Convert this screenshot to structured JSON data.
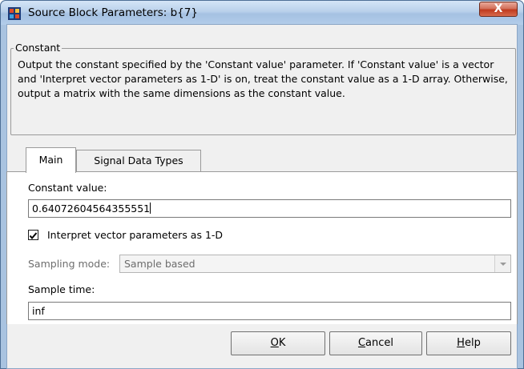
{
  "window": {
    "title": "Source Block Parameters: b{7}",
    "close_label": "X"
  },
  "block": {
    "group_label": "Constant",
    "description": "Output the constant specified by the 'Constant value' parameter. If 'Constant value' is a vector and 'Interpret vector parameters as 1-D' is on, treat the constant value as a 1-D array. Otherwise, output a matrix with the same dimensions as the constant value."
  },
  "tabs": [
    {
      "label": "Main",
      "active": true
    },
    {
      "label": "Signal Data Types",
      "active": false
    }
  ],
  "main": {
    "constant_value_label": "Constant value:",
    "constant_value": "0.64072604564355551",
    "interpret_vector_label": "Interpret vector parameters as 1-D",
    "interpret_vector_checked": true,
    "sampling_mode_label": "Sampling mode:",
    "sampling_mode_value": "Sample based",
    "sample_time_label": "Sample time:",
    "sample_time_value": "inf"
  },
  "buttons": {
    "ok": {
      "mnemonic": "O",
      "rest": "K"
    },
    "cancel": {
      "mnemonic": "C",
      "rest": "ancel"
    },
    "help": {
      "mnemonic": "H",
      "rest": "elp"
    }
  }
}
